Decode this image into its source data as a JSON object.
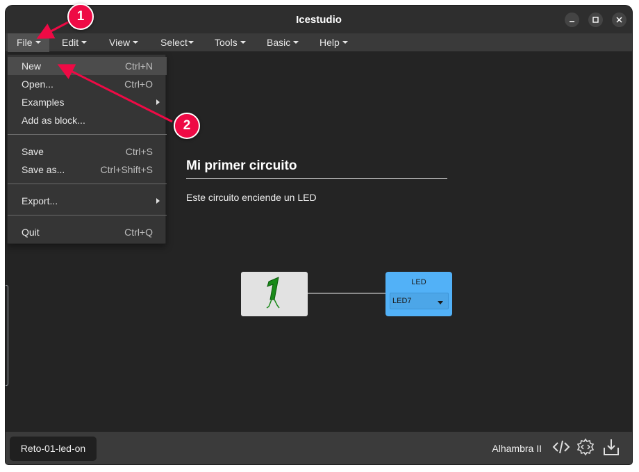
{
  "window": {
    "title": "Icestudio"
  },
  "menubar": {
    "items": [
      {
        "label": "File"
      },
      {
        "label": "Edit"
      },
      {
        "label": "View"
      },
      {
        "label": "Select"
      },
      {
        "label": "Tools"
      },
      {
        "label": "Basic"
      },
      {
        "label": "Help"
      }
    ]
  },
  "file_menu": {
    "items": [
      {
        "label": "New",
        "shortcut": "Ctrl+N",
        "highlighted": true
      },
      {
        "label": "Open...",
        "shortcut": "Ctrl+O"
      },
      {
        "label": "Examples",
        "submenu": true
      },
      {
        "label": "Add as block..."
      },
      {
        "label": "Save",
        "shortcut": "Ctrl+S"
      },
      {
        "label": "Save as...",
        "shortcut": "Ctrl+Shift+S"
      },
      {
        "label": "Export...",
        "submenu": true
      },
      {
        "label": "Quit",
        "shortcut": "Ctrl+Q"
      }
    ]
  },
  "canvas": {
    "info_title": "Mi primer circuito",
    "info_text": "Este circuito enciende un LED",
    "constant_block": {
      "value": "1",
      "color": "#1a8a1a"
    },
    "led_block": {
      "label": "LED",
      "selected_pin": "LED7",
      "color": "#52b1f7"
    }
  },
  "statusbar": {
    "project_name": "Reto-01-led-on",
    "board": "Alhambra II",
    "icons": [
      "code-icon",
      "gear-code-icon",
      "download-icon"
    ]
  },
  "annotations": [
    {
      "number": "1",
      "color": "#ee0a45"
    },
    {
      "number": "2",
      "color": "#ee0a45"
    }
  ]
}
